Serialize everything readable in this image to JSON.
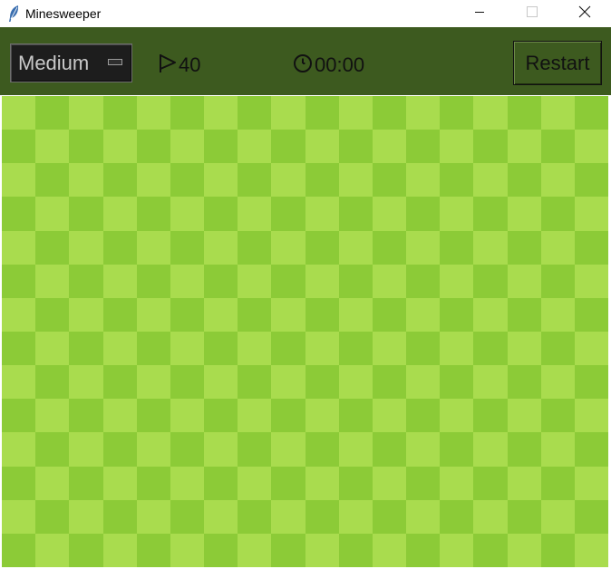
{
  "window": {
    "title": "Minesweeper",
    "icon": "feather-icon",
    "controls": [
      "minimize-icon",
      "maximize-icon",
      "close-icon"
    ]
  },
  "toolbar": {
    "background": "#3d5a1f",
    "difficulty": {
      "selected": "Medium"
    },
    "flags": {
      "icon": "flag-icon",
      "count": "40"
    },
    "timer": {
      "icon": "clock-icon",
      "value": "00:00"
    },
    "restart_label": "Restart"
  },
  "board": {
    "rows": 14,
    "cols": 18,
    "state": "all-cells-covered",
    "colors": {
      "light": "#a9dc4e",
      "dark": "#8ccb37"
    }
  }
}
